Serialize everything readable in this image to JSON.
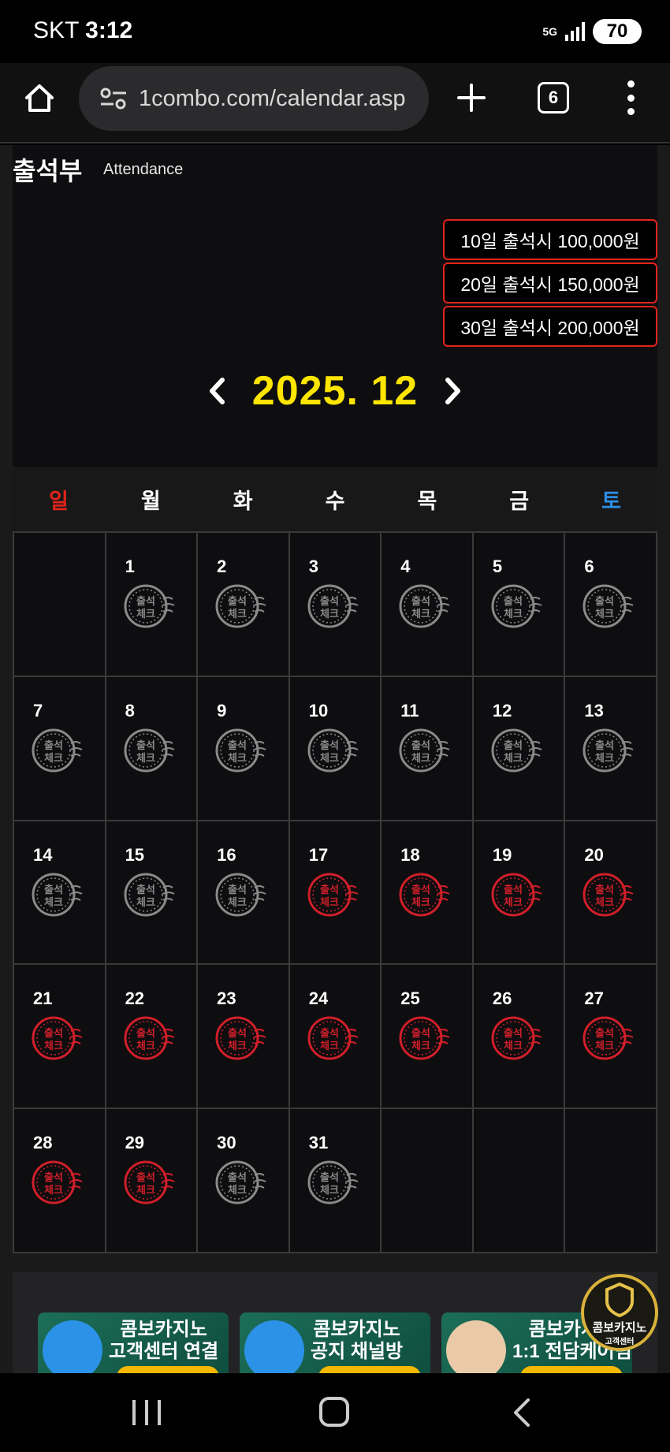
{
  "status_bar": {
    "carrier": "SKT",
    "time": "3:12",
    "network": "5G",
    "battery": "70"
  },
  "browser": {
    "url": "1combo.com/calendar.asp",
    "tab_count": "6"
  },
  "page": {
    "title": "출석부",
    "subtitle": "Attendance"
  },
  "rewards": [
    "10일 출석시 100,000원",
    "20일 출석시 150,000원",
    "30일 출석시 200,000원"
  ],
  "calendar": {
    "month_label": "2025. 12",
    "weekdays": [
      "일",
      "월",
      "화",
      "수",
      "목",
      "금",
      "토"
    ],
    "cells": [
      {
        "day": "",
        "state": "empty"
      },
      {
        "day": "1",
        "state": "unchecked"
      },
      {
        "day": "2",
        "state": "unchecked"
      },
      {
        "day": "3",
        "state": "unchecked"
      },
      {
        "day": "4",
        "state": "unchecked"
      },
      {
        "day": "5",
        "state": "unchecked"
      },
      {
        "day": "6",
        "state": "unchecked"
      },
      {
        "day": "7",
        "state": "unchecked"
      },
      {
        "day": "8",
        "state": "unchecked"
      },
      {
        "day": "9",
        "state": "unchecked"
      },
      {
        "day": "10",
        "state": "unchecked"
      },
      {
        "day": "11",
        "state": "unchecked"
      },
      {
        "day": "12",
        "state": "unchecked"
      },
      {
        "day": "13",
        "state": "unchecked"
      },
      {
        "day": "14",
        "state": "unchecked"
      },
      {
        "day": "15",
        "state": "unchecked"
      },
      {
        "day": "16",
        "state": "unchecked"
      },
      {
        "day": "17",
        "state": "checked"
      },
      {
        "day": "18",
        "state": "checked"
      },
      {
        "day": "19",
        "state": "checked"
      },
      {
        "day": "20",
        "state": "checked"
      },
      {
        "day": "21",
        "state": "checked"
      },
      {
        "day": "22",
        "state": "checked"
      },
      {
        "day": "23",
        "state": "checked"
      },
      {
        "day": "24",
        "state": "checked"
      },
      {
        "day": "25",
        "state": "checked"
      },
      {
        "day": "26",
        "state": "checked"
      },
      {
        "day": "27",
        "state": "checked"
      },
      {
        "day": "28",
        "state": "checked"
      },
      {
        "day": "29",
        "state": "checked"
      },
      {
        "day": "30",
        "state": "unchecked"
      },
      {
        "day": "31",
        "state": "unchecked"
      },
      {
        "day": "",
        "state": "empty"
      },
      {
        "day": "",
        "state": "empty"
      },
      {
        "day": "",
        "state": "empty"
      }
    ],
    "stamp_line1": "출석",
    "stamp_line2": "체크"
  },
  "banners": [
    {
      "line1": "콤보카지노",
      "line2": "고객센터 연결"
    },
    {
      "line1": "콤보카지노",
      "line2": "공지 채널방"
    },
    {
      "line1": "콤보카지노",
      "line2": "1:1 전담케어팀"
    }
  ],
  "cs_badge": {
    "line1": "콤보카지노",
    "line2": "고객센터"
  },
  "colors": {
    "accent_red": "#e3241c",
    "month_yellow": "#ffe600",
    "sat_blue": "#2c8fe6"
  }
}
